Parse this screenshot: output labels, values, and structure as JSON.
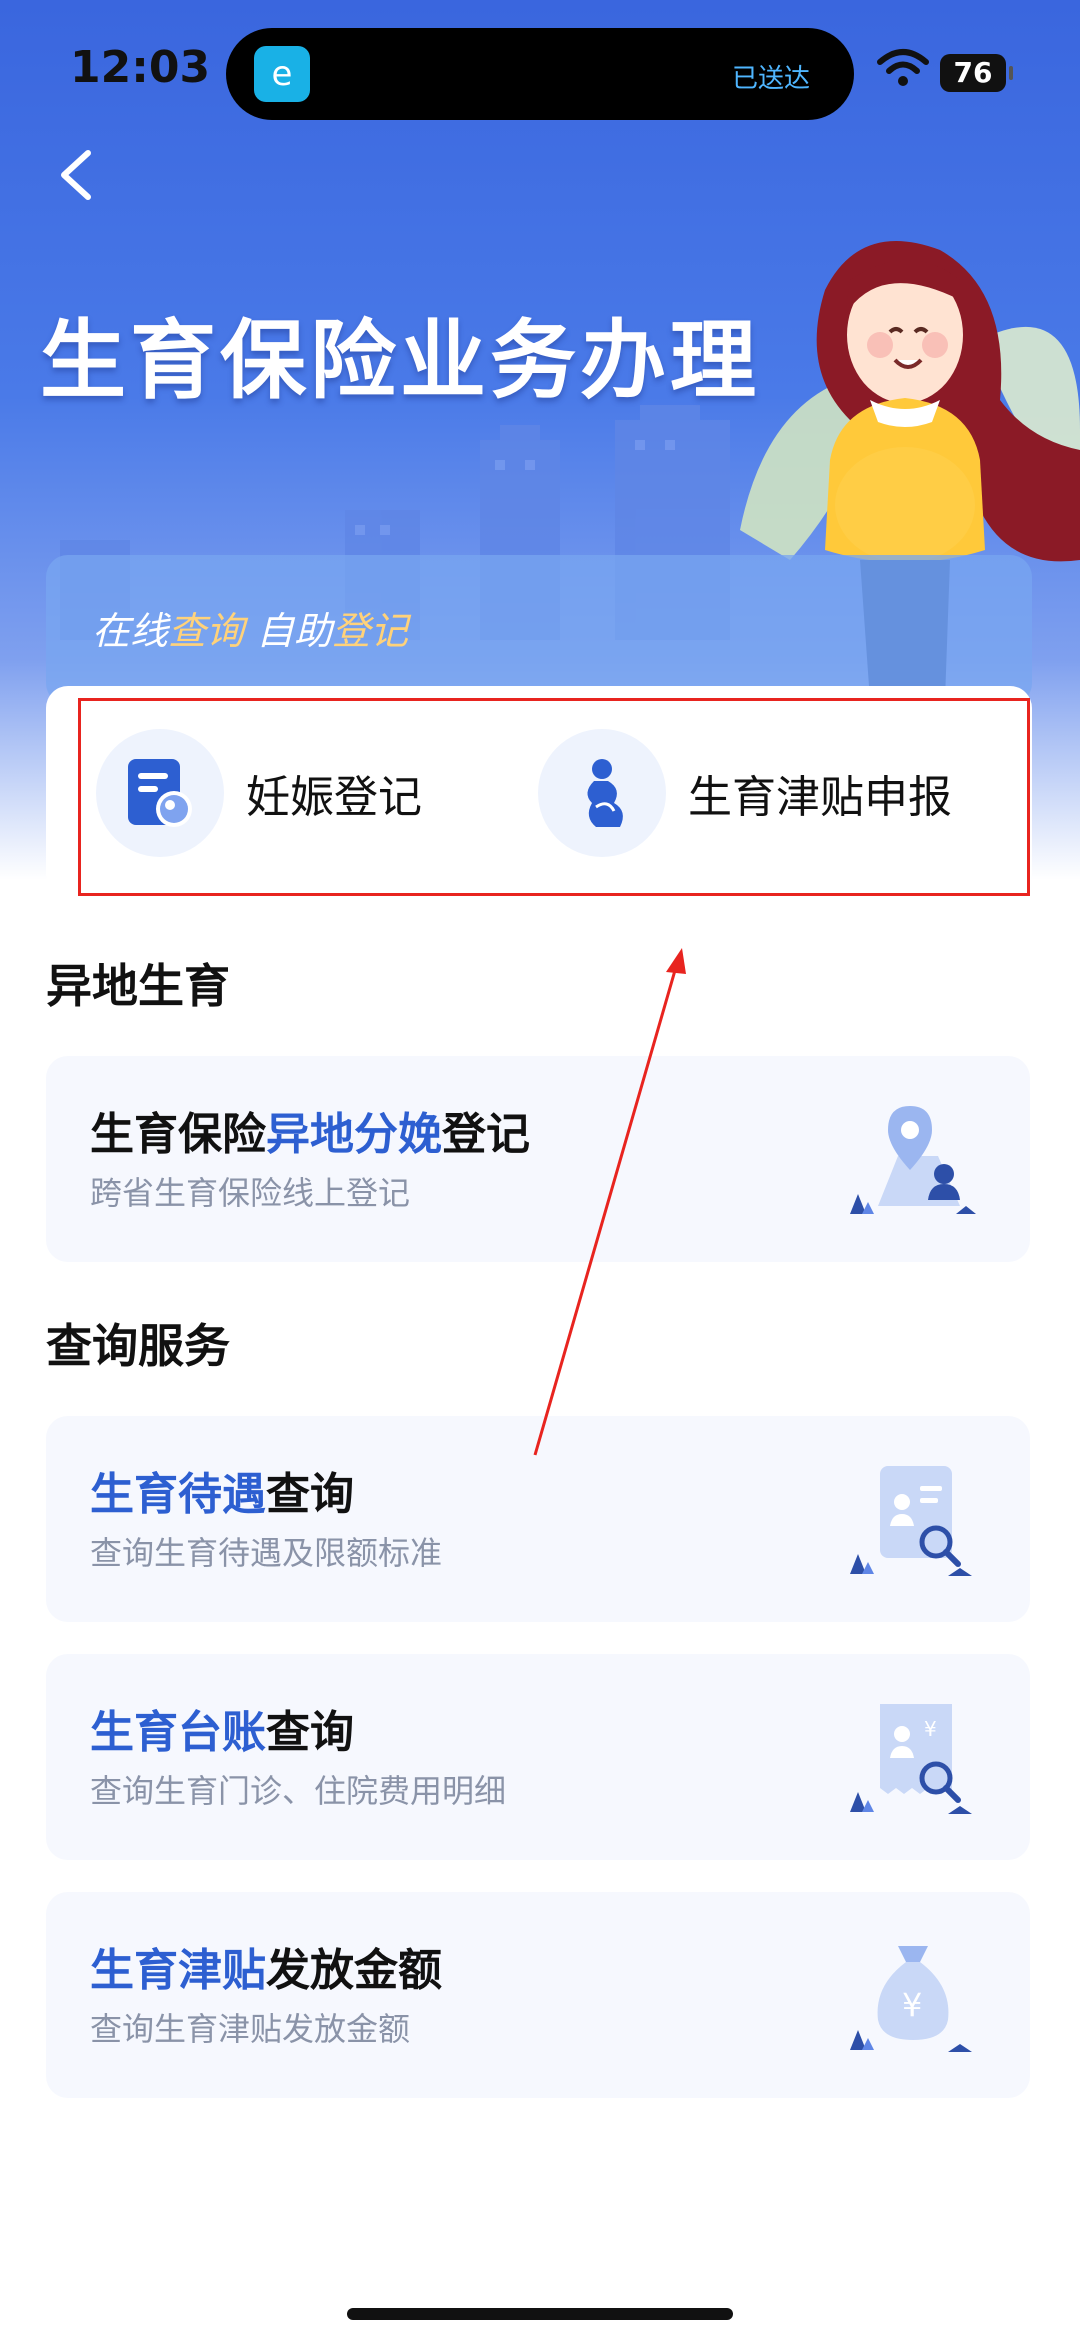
{
  "status_bar": {
    "time": "12:03",
    "app_badge": "e",
    "live_text": "已送达",
    "battery": "76"
  },
  "header": {
    "title": "生育保险业务办理"
  },
  "banner": {
    "part1": "在线",
    "part2": "查询",
    "part3": " 自助",
    "part4": "登记"
  },
  "quick_actions": [
    {
      "label": "妊娠登记",
      "icon": "pregnancy-register-icon"
    },
    {
      "label": "生育津贴申报",
      "icon": "pregnant-woman-icon"
    }
  ],
  "sections": {
    "offsite": {
      "title": "异地生育",
      "item": {
        "pre": "生育保险",
        "hl": "异地分娩",
        "post": "登记",
        "subtitle": "跨省生育保险线上登记",
        "icon": "location-person-icon"
      }
    },
    "query": {
      "title": "查询服务",
      "items": [
        {
          "hl": "生育待遇",
          "post": "查询",
          "subtitle": "查询生育待遇及限额标准",
          "icon": "document-search-icon"
        },
        {
          "hl": "生育台账",
          "post": "查询",
          "subtitle": "查询生育门诊、住院费用明细",
          "icon": "receipt-search-icon"
        },
        {
          "hl": "生育津贴",
          "post": "发放金额",
          "subtitle": "查询生育津贴发放金额",
          "icon": "money-bag-icon"
        }
      ]
    }
  },
  "colors": {
    "primary": "#3a66de",
    "highlight_blue": "#2d5fd1",
    "banner_gold": "#ffd27a",
    "annotation_red": "#e8241f"
  }
}
